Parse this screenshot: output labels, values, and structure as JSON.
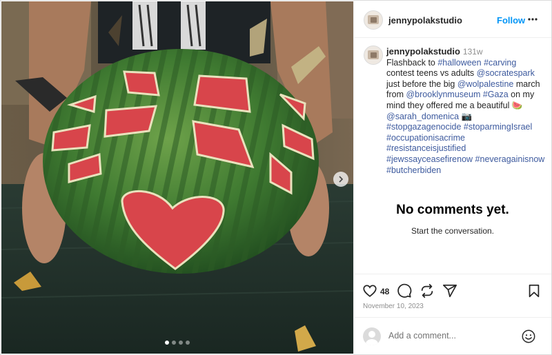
{
  "post": {
    "username": "jennypolakstudio",
    "follow_label": "Follow",
    "more_icon": "more-horizontal-icon"
  },
  "caption": {
    "username": "jennypolakstudio",
    "age": "131w",
    "segments": [
      {
        "t": "Flashback to ",
        "tag": false
      },
      {
        "t": "#halloween",
        "tag": true
      },
      {
        "t": " ",
        "tag": false
      },
      {
        "t": "#carving",
        "tag": true
      },
      {
        "t": " contest teens vs adults ",
        "tag": false
      },
      {
        "t": "@socratespark",
        "tag": true
      },
      {
        "t": "  just before the big ",
        "tag": false
      },
      {
        "t": "@wolpalestine",
        "tag": true
      },
      {
        "t": " march from ",
        "tag": false
      },
      {
        "t": "@brooklynmuseum",
        "tag": true
      },
      {
        "t": " ",
        "tag": false
      },
      {
        "t": "#Gaza",
        "tag": true
      },
      {
        "t": " on my mind they offered me a beautiful 🍉 ",
        "tag": false
      },
      {
        "t": "@sarah_domenica",
        "tag": true
      },
      {
        "t": " 📷 ",
        "tag": false
      },
      {
        "t": "#stopgazagenocide",
        "tag": true
      },
      {
        "t": " ",
        "tag": false
      },
      {
        "t": "#stoparmingIsrael",
        "tag": true
      },
      {
        "t": " ",
        "tag": false
      },
      {
        "t": "#occupationisacrime",
        "tag": true
      },
      {
        "t": " ",
        "tag": false
      },
      {
        "t": "#resistanceisjustified",
        "tag": true
      },
      {
        "t": " ",
        "tag": false
      },
      {
        "t": "#jewssayceasefirenow",
        "tag": true
      },
      {
        "t": " ",
        "tag": false
      },
      {
        "t": "#neveragainisnow",
        "tag": true
      },
      {
        "t": " ",
        "tag": false
      },
      {
        "t": "#butcherbiden",
        "tag": true
      }
    ]
  },
  "comments": {
    "empty_title": "No comments yet.",
    "empty_sub": "Start the conversation."
  },
  "actions": {
    "likes": "48",
    "date": "November 10, 2023",
    "icons": [
      "heart-icon",
      "comment-icon",
      "share-icon",
      "send-icon",
      "bookmark-icon"
    ]
  },
  "composer": {
    "placeholder": "Add a comment...",
    "emoji_icon": "emoji-icon"
  },
  "carousel": {
    "total_slides": 4,
    "active_slide": 1
  },
  "colors": {
    "link": "#3d5a9e",
    "follow": "#0095f6",
    "watermelon_rind": "#3d7a33",
    "watermelon_flesh": "#d8454b"
  }
}
